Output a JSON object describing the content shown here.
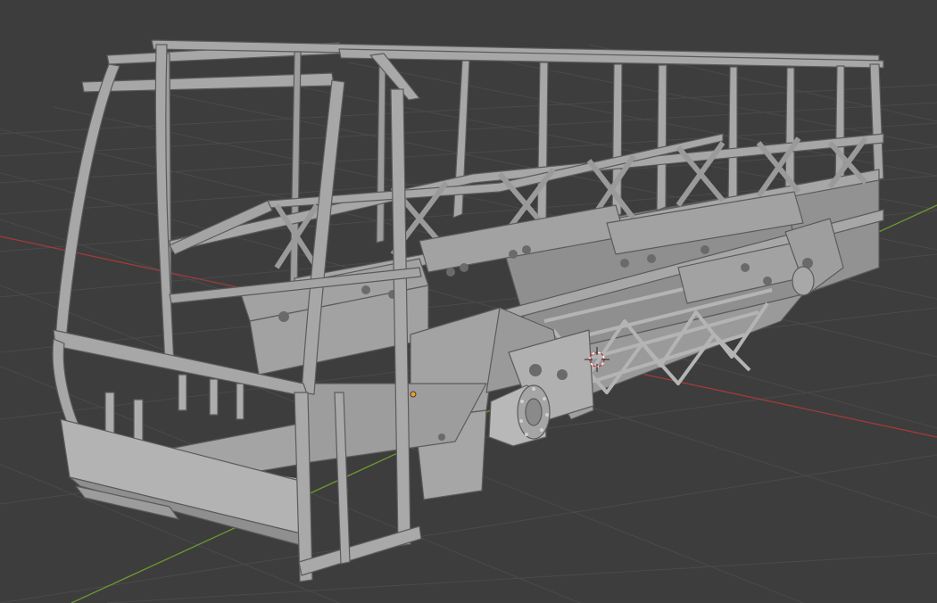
{
  "viewport": {
    "background": "#3d3d3d",
    "grid_color": "#4a4a4a",
    "x_axis_color": "#a33a3a",
    "y_axis_color": "#6c9a2e",
    "mesh_fill": "#a7a7a7",
    "mesh_edge": "#5b5b5b",
    "mesh_shade": "#8f8f8f",
    "origin_dot_color": "#f29b1d",
    "cursor_color": "#d93b3b"
  },
  "scene": {
    "object": "bus-frame-mesh",
    "gizmos": [
      "3d-cursor-icon",
      "object-origin-dot"
    ]
  }
}
